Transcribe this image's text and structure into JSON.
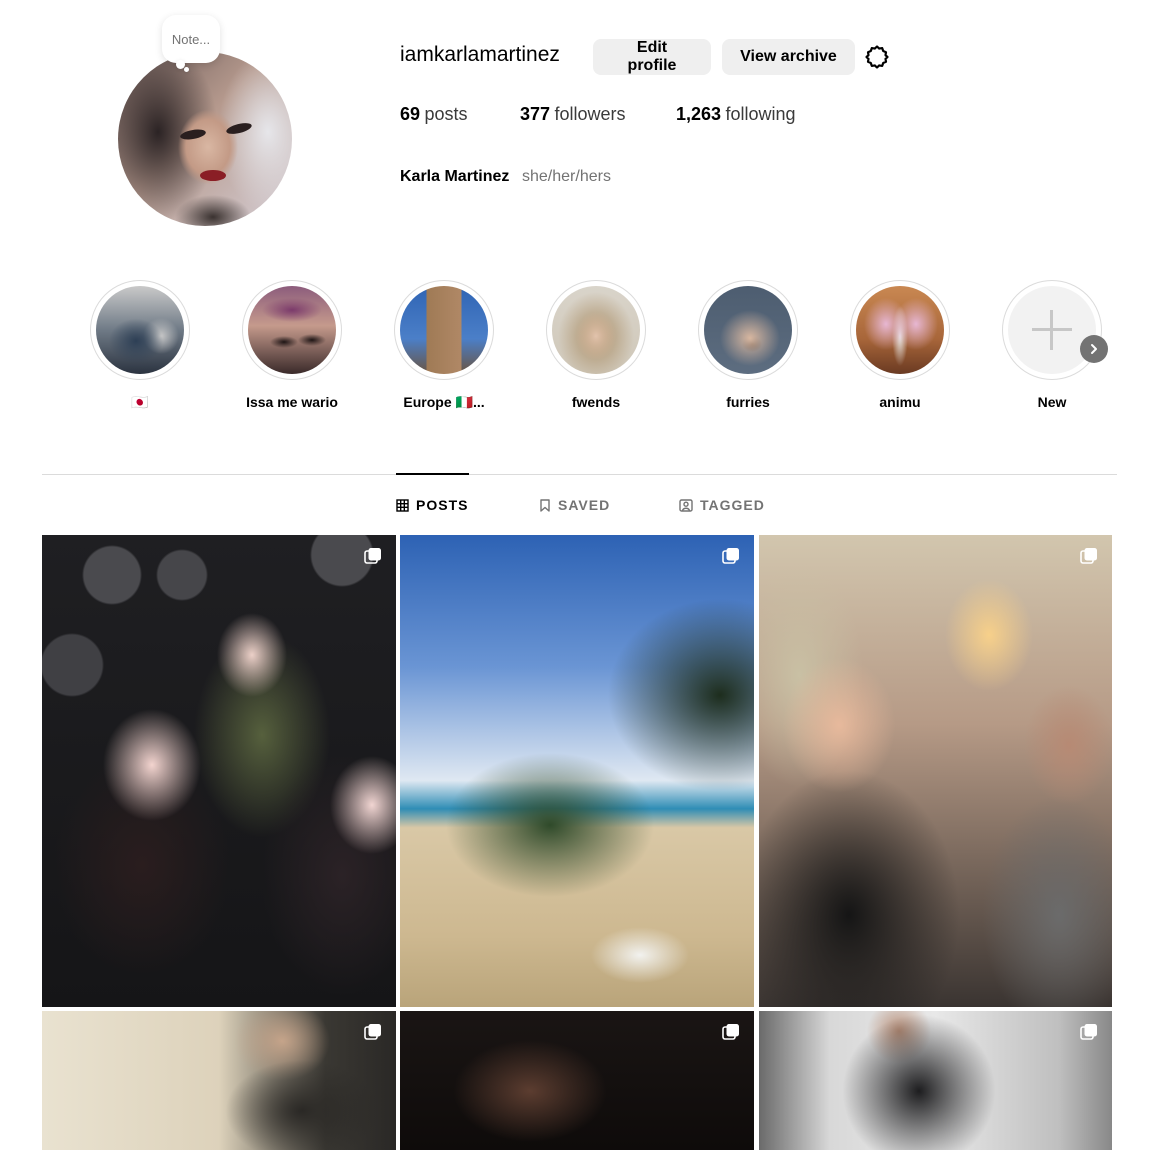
{
  "profile": {
    "username": "iamkarlamartinez",
    "note_placeholder": "Note...",
    "edit_profile_label": "Edit profile",
    "view_archive_label": "View archive",
    "settings_icon": "gear-icon",
    "stats": {
      "posts_count": "69",
      "posts_label": "posts",
      "followers_count": "377",
      "followers_label": "followers",
      "following_count": "1,263",
      "following_label": "following"
    },
    "full_name": "Karla Martinez",
    "pronouns": "she/her/hers"
  },
  "highlights": [
    {
      "label": "🇯🇵",
      "colors": [
        "#6f7a86",
        "#2d3f55"
      ]
    },
    {
      "label": "Issa me wario",
      "colors": [
        "#8c5c7c",
        "#c59a8c"
      ]
    },
    {
      "label": "Europe 🇮🇹...",
      "colors": [
        "#2f64b4",
        "#b08866"
      ]
    },
    {
      "label": "fwends",
      "colors": [
        "#d9d4ca",
        "#a88b62"
      ]
    },
    {
      "label": "furries",
      "colors": [
        "#4d5d70",
        "#d8b7a0"
      ]
    },
    {
      "label": "animu",
      "colors": [
        "#a8663a",
        "#e7b7d3"
      ]
    },
    {
      "label": "New",
      "colors": [
        "#f2f2f2",
        "#f2f2f2"
      ]
    }
  ],
  "highlights_next_icon": "chevron-right-icon",
  "tabs": {
    "posts": "POSTS",
    "saved": "SAVED",
    "tagged": "TAGGED",
    "active": "posts"
  },
  "grid": {
    "multi_icon": "multiple-photos-icon",
    "posts": [
      {
        "multiple": true
      },
      {
        "multiple": true
      },
      {
        "multiple": true
      },
      {
        "multiple": true
      },
      {
        "multiple": true
      },
      {
        "multiple": true
      }
    ]
  },
  "colors": {
    "button_bg": "#efefef",
    "secondary_text": "#737373",
    "divider": "#dbdbdb"
  }
}
